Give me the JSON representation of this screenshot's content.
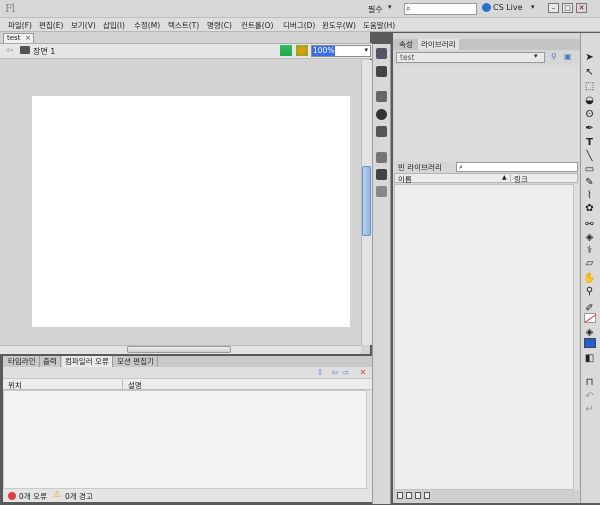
{
  "titlebar": {
    "app_logo": "Fl",
    "workspace": "필수",
    "workspace_arrow": "▾",
    "search_placeholder": "",
    "search_icon": "⌕",
    "cslive": "CS Live",
    "cslive_arrow": "▾",
    "minimize": "–",
    "maximize": "□",
    "close": "✕"
  },
  "menu": [
    "파일(F)",
    "편집(E)",
    "보기(V)",
    "삽입(I)",
    "수정(M)",
    "텍스트(T)",
    "명령(C)",
    "컨트롤(O)",
    "디버그(D)",
    "윈도우(W)",
    "도움말(H)"
  ],
  "document": {
    "tab": "test",
    "tab_close": "×",
    "scene": "장면 1",
    "zoom": "100%",
    "zoom_arrow": "▾",
    "back_arrow": "⇦"
  },
  "bottom_panel": {
    "tabs": [
      "타임라인",
      "출력",
      "컴파일러 오류",
      "모션 편집기"
    ],
    "active_tab": "컴파일러 오류",
    "columns": [
      "위치",
      "설명"
    ],
    "errors": "0개 오류",
    "warnings": "0개 경고",
    "warn_icon": "⚠",
    "toolbar_icons": [
      "⇧",
      "⇦",
      "⇨",
      "✕"
    ]
  },
  "right_panel": {
    "tabs": [
      "속성",
      "라이브러리"
    ],
    "active_tab": "라이브러리",
    "library_select": "test",
    "select_arrow": "▾",
    "empty_label": "빈 라이브러리",
    "search_icon": "⌕",
    "columns": [
      "이름",
      "링크"
    ],
    "sort_arrow": "▲",
    "pin_icon": "⚲",
    "new_icon": "▣"
  },
  "colors": {
    "accent": "#3a6ee8",
    "fill": "#1f5fd6",
    "stroke": "#e22222",
    "error": "#e03d3d",
    "warning": "#d8a400"
  }
}
